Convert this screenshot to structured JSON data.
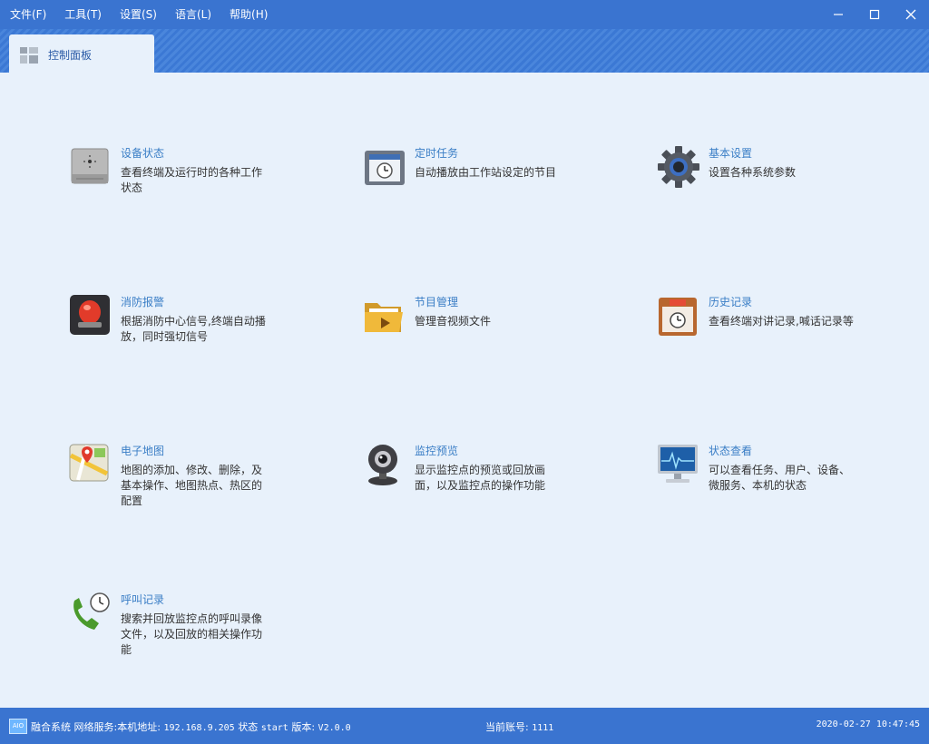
{
  "menu": [
    {
      "label": "文件(F)"
    },
    {
      "label": "工具(T)"
    },
    {
      "label": "设置(S)"
    },
    {
      "label": "语言(L)"
    },
    {
      "label": "帮助(H)"
    }
  ],
  "window_controls": {
    "minimize": "—",
    "maximize": "☐",
    "close": "✕"
  },
  "tab": {
    "label": "控制面板",
    "icon": "panel-icon"
  },
  "cards": [
    {
      "title": "设备状态",
      "desc": "查看终端及运行时的各种工作状态",
      "icon": "device-icon"
    },
    {
      "title": "定时任务",
      "desc": "自动播放由工作站设定的节目",
      "icon": "schedule-icon"
    },
    {
      "title": "基本设置",
      "desc": "设置各种系统参数",
      "icon": "gear-icon"
    },
    {
      "title": "消防报警",
      "desc": "根据消防中心信号,终端自动播放，同时强切信号",
      "icon": "alarm-icon"
    },
    {
      "title": "节目管理",
      "desc": "管理音视频文件",
      "icon": "folder-icon"
    },
    {
      "title": "历史记录",
      "desc": "查看终端对讲记录,喊话记录等",
      "icon": "calendar-icon"
    },
    {
      "title": "电子地图",
      "desc": "地图的添加、修改、删除，及基本操作、地图热点、热区的配置",
      "icon": "map-icon"
    },
    {
      "title": "监控预览",
      "desc": "显示监控点的预览或回放画面，以及监控点的操作功能",
      "icon": "camera-icon"
    },
    {
      "title": "状态查看",
      "desc": "可以查看任务、用户、设备、微服务、本机的状态",
      "icon": "monitor-icon"
    },
    {
      "title": "呼叫记录",
      "desc": "搜索并回放监控点的呼叫录像文件，以及回放的相关操作功能",
      "icon": "phone-icon"
    }
  ],
  "status": {
    "logo": "AIO",
    "system": "融合系统",
    "network_label": "网络服务:",
    "address_label": "本机地址:",
    "address": "192.168.9.205",
    "state_label": "状态",
    "state": "start",
    "version_label": "版本:",
    "version": "V2.0.0",
    "account_label": "当前账号:",
    "account": "1111",
    "datetime": "2020-02-27 10:47:45"
  },
  "colors": {
    "title_bar": "#3a74d0",
    "content_bg": "#e8f1fb",
    "card_title": "#3a7ec6"
  }
}
